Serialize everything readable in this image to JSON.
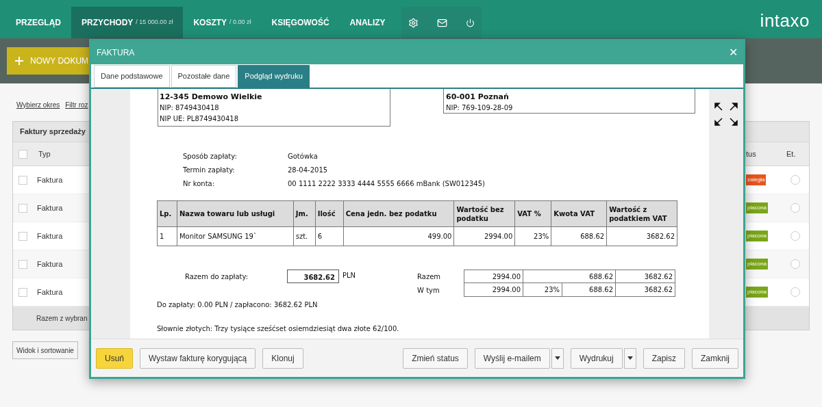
{
  "nav": {
    "items": [
      {
        "label": "PRZEGLĄD",
        "selected": false
      },
      {
        "label": "PRZYCHODY",
        "amount": "/ 15 000.00 zł",
        "selected": true
      },
      {
        "label": "KOSZTY",
        "amount": "/ 0.00 zł",
        "selected": false
      },
      {
        "label": "KSIĘGOWOŚĆ",
        "selected": false
      },
      {
        "label": "ANALIZY",
        "selected": false
      }
    ],
    "logo": "intaxo"
  },
  "toolbar": {
    "new_button": "NOWY DOKUM",
    "filters": [
      "Wybierz okres",
      "Filtr roz"
    ]
  },
  "table": {
    "title": "Faktury sprzedaży",
    "all_checked": false,
    "columns": [
      "Typ",
      "tus",
      "Et."
    ],
    "rows": [
      {
        "type": "Faktura",
        "checked": false,
        "status": "zaległa",
        "color": "#e8541c",
        "selected": false
      },
      {
        "type": "Faktura",
        "checked": false,
        "status": "płacona",
        "color": "#7aa619",
        "selected": false
      },
      {
        "type": "Faktura",
        "checked": false,
        "status": "płacona",
        "color": "#7aa619",
        "selected": false
      },
      {
        "type": "Faktura",
        "checked": false,
        "status": "płacona",
        "color": "#7aa619",
        "selected": false
      },
      {
        "type": "Faktura",
        "checked": false,
        "status": "płacona",
        "color": "#7aa619",
        "selected": false
      }
    ],
    "footer": "Razem z wybran"
  },
  "view_button": "Widok i sortowanie",
  "modal": {
    "title": "FAKTURA",
    "close": "✕",
    "tabs": [
      {
        "label": "Dane podstawowe",
        "selected": false
      },
      {
        "label": "Pozostałe dane",
        "selected": false
      },
      {
        "label": "Podgląd wydruku",
        "selected": true
      }
    ],
    "document": {
      "seller": [
        "12-345 Demowo Wielkie",
        "NIP: 8749430418",
        "NIP UE: PL8749430418"
      ],
      "buyer": [
        "60-001 Poznań",
        "NIP: 769-109-28-09"
      ],
      "payment": [
        {
          "label": "Sposób zapłaty:",
          "value": "Gotówka"
        },
        {
          "label": "Termin zapłaty:",
          "value": "28-04-2015"
        },
        {
          "label": "Nr konta:",
          "value": "00 1111 2222 3333 4444 5555 6666 mBank (SW012345)"
        }
      ],
      "items": {
        "columns": [
          "Lp.",
          "Nazwa towaru lub usługi",
          "Jm.",
          "Ilość",
          "Cena jedn. bez podatku",
          "Wartość bez podatku",
          "VAT %",
          "Kwota VAT",
          "Wartość z podatkiem VAT"
        ],
        "rows": [
          [
            "1",
            "Monitor SAMSUNG 19`",
            "szt.",
            "6",
            "499.00",
            "2994.00",
            "23%",
            "688.62",
            "3682.62"
          ]
        ]
      },
      "total_label": "Razem do zapłaty:",
      "total": "3682.62",
      "currency": "PLN",
      "summary": [
        {
          "label": "Razem",
          "cells": [
            "2994.00",
            "",
            "688.62",
            "3682.62"
          ]
        },
        {
          "label": "W tym",
          "cells": [
            "2994.00",
            "23%",
            "688.62",
            "3682.62"
          ]
        }
      ],
      "paid": "Do zapłaty: 0.00 PLN / zapłacono: 3682.62 PLN",
      "in_words": "Słownie złotych: Trzy tysiące sześćset osiemdziesiąt dwa złote 62/100."
    },
    "buttons_left": [
      {
        "label": "Usuń",
        "kind": "primary"
      },
      {
        "label": "Wystaw fakturę korygującą",
        "kind": "default"
      },
      {
        "label": "Klonuj",
        "kind": "default"
      }
    ],
    "buttons_right": [
      {
        "label": "Zmień status",
        "kind": "default"
      },
      {
        "label": "Wyślij e-mailem",
        "kind": "split"
      },
      {
        "label": "Wydrukuj",
        "kind": "split"
      },
      {
        "label": "Zapisz",
        "kind": "default"
      },
      {
        "label": "Zamknij",
        "kind": "default"
      }
    ]
  }
}
